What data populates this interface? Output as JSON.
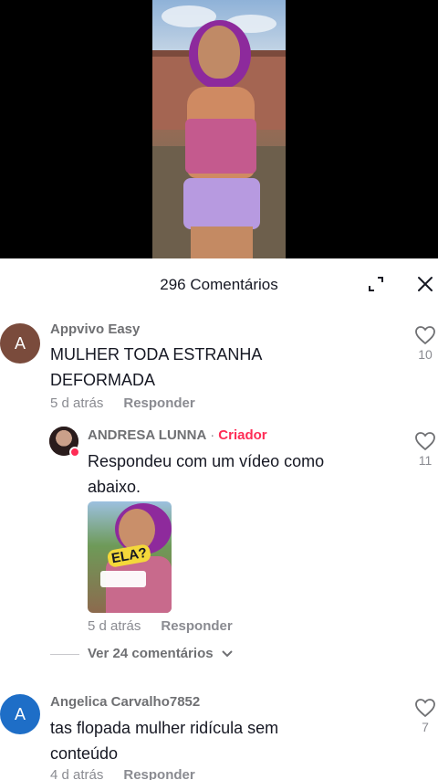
{
  "header": {
    "title": "296 Comentários"
  },
  "comments": [
    {
      "avatar_letter": "A",
      "avatar_color": "#7a4b3c",
      "username": "Appvivo Easy",
      "text_line1": "MULHER TODA ESTRANHA",
      "text_line2": "DEFORMADA",
      "time": "5 d atrás",
      "reply_label": "Responder",
      "likes": "10"
    },
    {
      "avatar_letter": "A",
      "avatar_color": "#1e6ec7",
      "username": "Angelica Carvalho7852",
      "text_line1": "tas flopada mulher ridícula sem",
      "text_line2": "conteúdo",
      "time": "4 d atrás",
      "reply_label": "Responder",
      "likes": "7"
    }
  ],
  "reply": {
    "username": "ANDRESA LUNNA",
    "separator": "·",
    "role": "Criador",
    "text_line1": "Respondeu com um vídeo como",
    "text_line2": "abaixo.",
    "time": "5 d atrás",
    "reply_label": "Responder",
    "likes": "11",
    "sticker_text": "ELA?"
  },
  "more_replies": "Ver 24 comentários",
  "colors": {
    "accent": "#fe2c55",
    "text": "#161823",
    "muted": "#8a8b91"
  }
}
